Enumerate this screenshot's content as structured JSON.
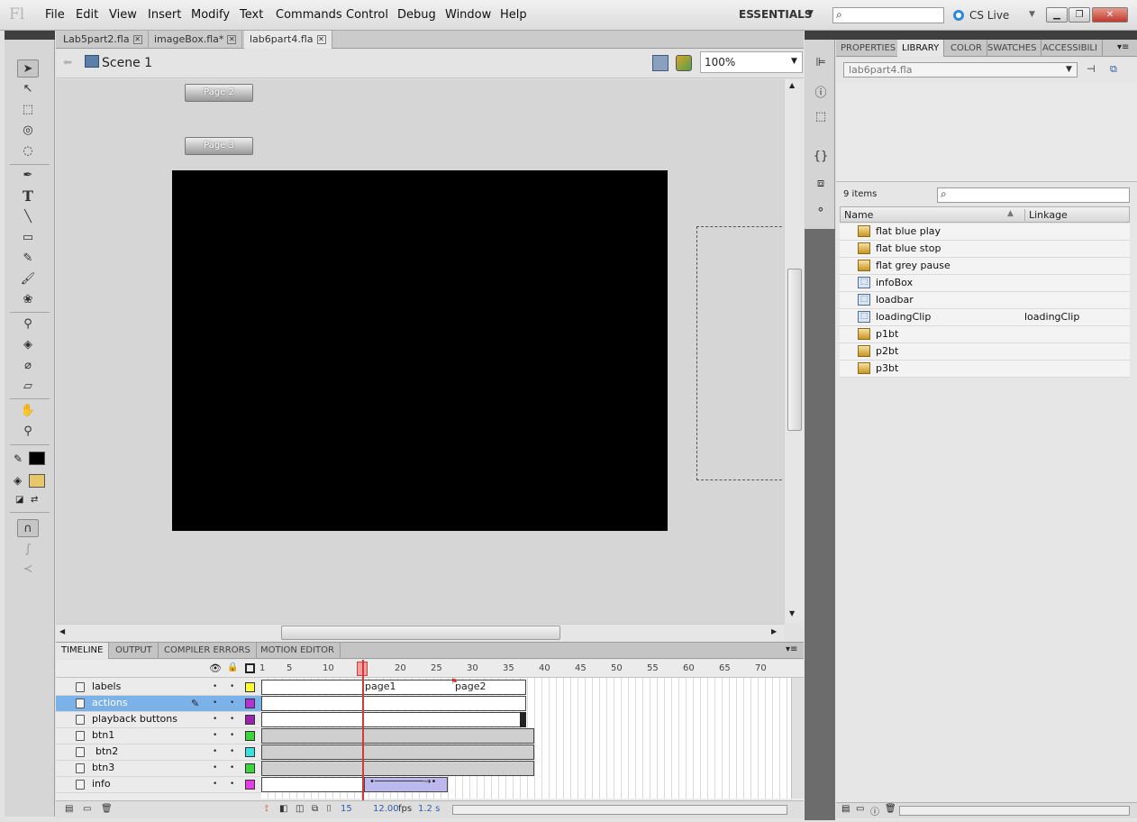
{
  "menu": {
    "logo": "Fl",
    "items": [
      "File",
      "Edit",
      "View",
      "Insert",
      "Modify",
      "Text",
      "Commands",
      "Control",
      "Debug",
      "Window",
      "Help"
    ],
    "workspace": "ESSENTIALS",
    "cs_live": "CS Live"
  },
  "doc_tabs": [
    {
      "label": "Lab5part2.fla"
    },
    {
      "label": "imageBox.fla*"
    },
    {
      "label": "lab6part4.fla",
      "active": true
    }
  ],
  "editbar": {
    "scene": "Scene 1",
    "zoom": "100%"
  },
  "stage": {
    "buttons": [
      "Page 2",
      "Page 3"
    ],
    "background": "#000000"
  },
  "timeline": {
    "tabs": [
      "TIMELINE",
      "OUTPUT",
      "COMPILER ERRORS",
      "MOTION EDITOR"
    ],
    "ruler": [
      "1",
      "5",
      "10",
      "15",
      "20",
      "25",
      "30",
      "35",
      "40",
      "45",
      "50",
      "55",
      "60",
      "65",
      "70"
    ],
    "layers": [
      {
        "name": "labels",
        "color": "#ffff33"
      },
      {
        "name": "actions",
        "color": "#b431d6",
        "selected": true
      },
      {
        "name": "playback buttons",
        "color": "#9a24b0"
      },
      {
        "name": "btn1",
        "color": "#3ad63a"
      },
      {
        "name": "btn2",
        "color": "#3ae0e0"
      },
      {
        "name": "btn3",
        "color": "#3ad63a"
      },
      {
        "name": "info",
        "color": "#e83ae8"
      }
    ],
    "frame_labels": [
      "page1",
      "page2"
    ],
    "current_frame": "15",
    "fps": "12.00",
    "fps_unit": "fps",
    "elapsed": "1.2 s"
  },
  "library": {
    "tabs": [
      "PROPERTIES",
      "LIBRARY",
      "COLOR",
      "SWATCHES",
      "ACCESSIBILI"
    ],
    "document": "lab6part4.fla",
    "count": "9 items",
    "col_name": "Name",
    "col_linkage": "Linkage",
    "items": [
      {
        "name": "flat blue play",
        "type": "button",
        "linkage": ""
      },
      {
        "name": "flat blue stop",
        "type": "button",
        "linkage": ""
      },
      {
        "name": "flat grey pause",
        "type": "button",
        "linkage": ""
      },
      {
        "name": "infoBox",
        "type": "movieclip",
        "linkage": ""
      },
      {
        "name": "loadbar",
        "type": "movieclip",
        "linkage": ""
      },
      {
        "name": "loadingClip",
        "type": "movieclip",
        "linkage": "loadingClip"
      },
      {
        "name": "p1bt",
        "type": "button",
        "linkage": ""
      },
      {
        "name": "p2bt",
        "type": "button",
        "linkage": ""
      },
      {
        "name": "p3bt",
        "type": "button",
        "linkage": ""
      }
    ]
  }
}
